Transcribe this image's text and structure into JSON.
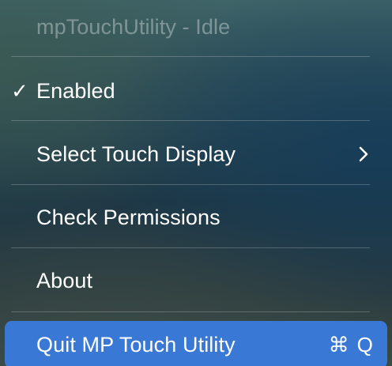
{
  "menu": {
    "title": "mpTouchUtility - Idle",
    "items": [
      {
        "label": "Enabled",
        "checked": true,
        "check_glyph": "✓",
        "icon": "checkmark-icon"
      },
      {
        "label": "Select Touch Display",
        "has_submenu": true,
        "icon": "chevron-right-icon"
      },
      {
        "label": "Check Permissions"
      },
      {
        "label": "About"
      },
      {
        "label": "Quit MP Touch Utility",
        "highlighted": true,
        "shortcut_modifier": "⌘",
        "shortcut_key": "Q"
      }
    ]
  },
  "colors": {
    "highlight": "#3a78d6",
    "text": "#ffffff",
    "disabled_text": "rgba(255,255,255,0.35)"
  }
}
